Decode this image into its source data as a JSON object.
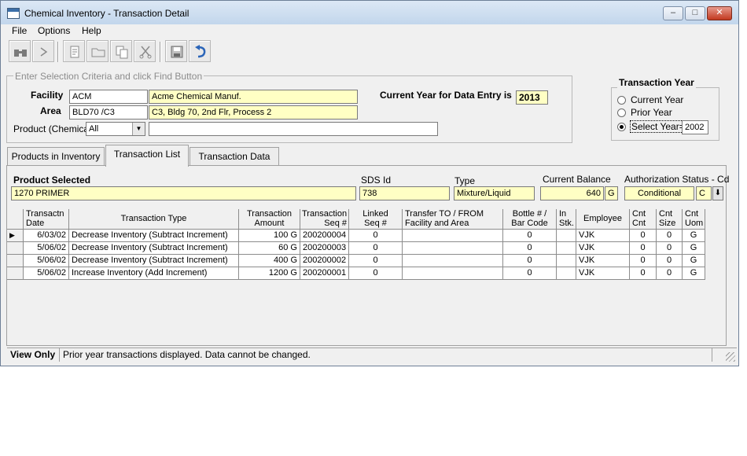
{
  "window": {
    "title": "Chemical Inventory - Transaction Detail"
  },
  "menu": {
    "file": "File",
    "options": "Options",
    "help": "Help"
  },
  "criteria": {
    "legend": "Enter Selection Criteria and click Find Button",
    "facility_label": "Facility",
    "facility_code": "ACM",
    "facility_name": "Acme Chemical Manuf.",
    "area_label": "Area",
    "area_code": "BLD70 /C3",
    "area_name": "C3, Bldg 70, 2nd Flr, Process 2",
    "product_label": "Product (Chemical)",
    "product_combo": "All",
    "product_text": "",
    "current_year_label": "Current Year for Data Entry is",
    "current_year": "2013"
  },
  "transaction_year": {
    "legend": "Transaction Year",
    "options": [
      "Current Year",
      "Prior Year",
      "Select Year="
    ],
    "selected": "Select Year=",
    "select_year_value": "2002"
  },
  "tabs": [
    "Products in Inventory",
    "Transaction List",
    "Transaction Data"
  ],
  "active_tab": "Transaction List",
  "product": {
    "selected_label": "Product Selected",
    "selected_value": "1270 PRIMER",
    "sds_label": "SDS Id",
    "sds_value": "738",
    "type_label": "Type",
    "type_value": "Mixture/Liquid",
    "balance_label": "Current Balance",
    "balance_value": "640",
    "balance_uom": "G",
    "auth_label": "Authorization Status - Cd",
    "auth_value": "Conditional",
    "auth_code": "C"
  },
  "grid": {
    "headers": [
      "Transactn Date",
      "Transaction Type",
      "Transaction Amount",
      "Transaction Seq #",
      "Linked Seq #",
      "Transfer TO / FROM Facility and Area",
      "Bottle # / Bar Code",
      "In Stk.",
      "Employee",
      "Cnt Cnt",
      "Cnt Size",
      "Cnt Uom"
    ],
    "rows": [
      {
        "date": "6/03/02",
        "type": "Decrease Inventory (Subtract Increment)",
        "amount": "100 G",
        "seq": "200200004",
        "linked": "0",
        "transfer": "",
        "bottle": "0",
        "instk": "",
        "emp": "VJK",
        "cnt": "0",
        "size": "0",
        "uom": "G"
      },
      {
        "date": "5/06/02",
        "type": "Decrease Inventory (Subtract Increment)",
        "amount": "60 G",
        "seq": "200200003",
        "linked": "0",
        "transfer": "",
        "bottle": "0",
        "instk": "",
        "emp": "VJK",
        "cnt": "0",
        "size": "0",
        "uom": "G"
      },
      {
        "date": "5/06/02",
        "type": "Decrease Inventory (Subtract Increment)",
        "amount": "400 G",
        "seq": "200200002",
        "linked": "0",
        "transfer": "",
        "bottle": "0",
        "instk": "",
        "emp": "VJK",
        "cnt": "0",
        "size": "0",
        "uom": "G"
      },
      {
        "date": "5/06/02",
        "type": "Increase Inventory (Add Increment)",
        "amount": "1200 G",
        "seq": "200200001",
        "linked": "0",
        "transfer": "",
        "bottle": "0",
        "instk": "",
        "emp": "VJK",
        "cnt": "0",
        "size": "0",
        "uom": "G"
      }
    ]
  },
  "status": {
    "mode": "View Only",
    "message": "Prior year transactions displayed.  Data cannot be changed."
  }
}
